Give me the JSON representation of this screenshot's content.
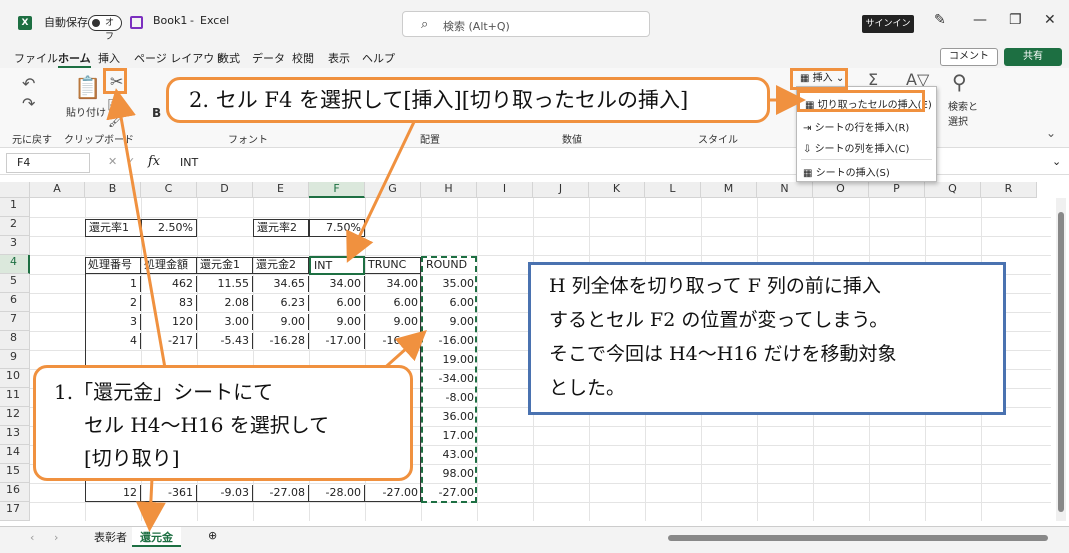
{
  "titlebar": {
    "autosave": "自動保存",
    "toggle": "オフ",
    "book": "Book1",
    "sep": "-",
    "app": "Excel",
    "search_placeholder": "検索 (Alt+Q)",
    "signin": "サインイン"
  },
  "menu": [
    "ファイル",
    "ホーム",
    "挿入",
    "ページ レイアウト",
    "数式",
    "データ",
    "校閲",
    "表示",
    "ヘルプ"
  ],
  "menu_right": {
    "comment": "コメント",
    "share": "共有"
  },
  "ribbon": {
    "undo": "元に戻す",
    "clipboard": "クリップボード",
    "paste": "貼り付け",
    "font": "フォント",
    "align": "配置",
    "number": "数値",
    "style": "スタイル",
    "insert": "挿入",
    "find": "検索と\n選択"
  },
  "dropdown": [
    "切り取ったセルの挿入(E)",
    "シートの行を挿入(R)",
    "シートの列を挿入(C)",
    "シートの挿入(S)"
  ],
  "formula": {
    "namebox": "F4",
    "fx": "fx",
    "content": "INT"
  },
  "columns": [
    "A",
    "B",
    "C",
    "D",
    "E",
    "F",
    "G",
    "H",
    "I",
    "J",
    "K",
    "L",
    "M",
    "N",
    "O",
    "P",
    "Q",
    "R"
  ],
  "rows": [
    "1",
    "2",
    "3",
    "4",
    "5",
    "6",
    "7",
    "8",
    "9",
    "10",
    "11",
    "12",
    "13",
    "14",
    "15",
    "16",
    "17"
  ],
  "cells": {
    "B2": "還元率1",
    "C2": "2.50%",
    "E2": "還元率2",
    "F2": "7.50%",
    "headers": [
      "処理番号",
      "処理金額",
      "還元金1",
      "還元金2",
      "INT",
      "TRUNC",
      "ROUND"
    ],
    "data": [
      [
        "1",
        "462",
        "11.55",
        "34.65",
        "34.00",
        "34.00",
        "35.00"
      ],
      [
        "2",
        "83",
        "2.08",
        "6.23",
        "6.00",
        "6.00",
        "6.00"
      ],
      [
        "3",
        "120",
        "3.00",
        "9.00",
        "9.00",
        "9.00",
        "9.00"
      ],
      [
        "4",
        "-217",
        "-5.43",
        "-16.28",
        "-17.00",
        "-16.00",
        "-16.00"
      ]
    ],
    "round_rest": [
      "19.00",
      "-34.00",
      "-8.00",
      "36.00",
      "17.00",
      "43.00",
      "98.00"
    ],
    "row16": [
      "12",
      "-361",
      "-9.03",
      "-27.08",
      "-28.00",
      "-27.00",
      "-27.00"
    ]
  },
  "tabs": [
    "表彰者",
    "還元金",
    "⊕"
  ],
  "callouts": {
    "step2": "2. セル F4 を選択して[挿入][切り取ったセルの挿入]",
    "step1_line1": "1.「還元金」シートにて",
    "step1_line2": "セル H4〜H16 を選択して",
    "step1_line3": "[切り取り]",
    "note_line1": "H 列全体を切り取って F 列の前に挿入",
    "note_line2": "するとセル F2 の位置が変ってしまう。",
    "note_line3": "そこで今回は H4〜H16 だけを移動対象",
    "note_line4": "とした。"
  }
}
